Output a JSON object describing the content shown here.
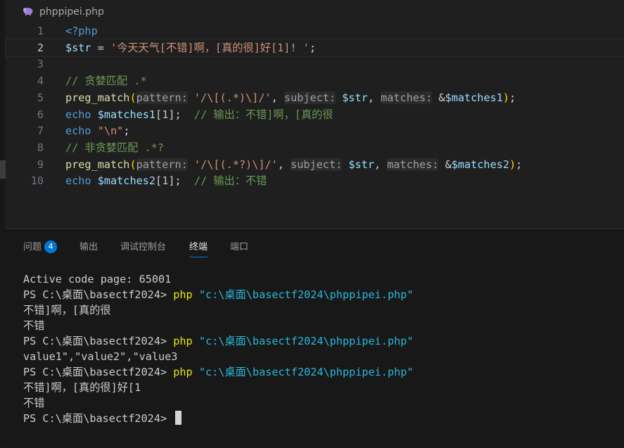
{
  "tab": {
    "filename": "phppipei.php",
    "icon": "php-elephant-icon"
  },
  "editor": {
    "lines": [
      {
        "num": "1",
        "parts": [
          {
            "c": "t-tag",
            "t": "<?php"
          }
        ]
      },
      {
        "num": "2",
        "active": true,
        "parts": [
          {
            "c": "t-var",
            "t": "$str"
          },
          {
            "c": "t-op",
            "t": " = "
          },
          {
            "c": "t-str",
            "t": "'今天天气[不错]啊，[真的很]好[1]! '"
          },
          {
            "c": "t-pun",
            "t": ";"
          }
        ]
      },
      {
        "num": "3",
        "parts": []
      },
      {
        "num": "4",
        "parts": [
          {
            "c": "t-com",
            "t": "// 贪婪匹配 .*"
          }
        ]
      },
      {
        "num": "5",
        "parts": [
          {
            "c": "t-fn",
            "t": "preg_match"
          },
          {
            "c": "t-br",
            "t": "("
          },
          {
            "c": "t-hint",
            "t": "pattern:"
          },
          {
            "c": "t-pun",
            "t": " "
          },
          {
            "c": "t-str",
            "t": "'/\\[(.*)\\]/'"
          },
          {
            "c": "t-pun",
            "t": ", "
          },
          {
            "c": "t-hint",
            "t": "subject:"
          },
          {
            "c": "t-pun",
            "t": " "
          },
          {
            "c": "t-var",
            "t": "$str"
          },
          {
            "c": "t-pun",
            "t": ", "
          },
          {
            "c": "t-hint",
            "t": "matches:"
          },
          {
            "c": "t-pun",
            "t": " &"
          },
          {
            "c": "t-var",
            "t": "$matches1"
          },
          {
            "c": "t-br",
            "t": ")"
          },
          {
            "c": "t-pun",
            "t": ";"
          }
        ]
      },
      {
        "num": "6",
        "parts": [
          {
            "c": "t-tag",
            "t": "echo"
          },
          {
            "c": "t-pun",
            "t": " "
          },
          {
            "c": "t-var",
            "t": "$matches1"
          },
          {
            "c": "t-pun",
            "t": "["
          },
          {
            "c": "t-num",
            "t": "1"
          },
          {
            "c": "t-pun",
            "t": "];  "
          },
          {
            "c": "t-com",
            "t": "// 输出：不错]啊，[真的很"
          }
        ]
      },
      {
        "num": "7",
        "parts": [
          {
            "c": "t-tag",
            "t": "echo"
          },
          {
            "c": "t-pun",
            "t": " "
          },
          {
            "c": "t-str",
            "t": "\"\\n\""
          },
          {
            "c": "t-pun",
            "t": ";"
          }
        ]
      },
      {
        "num": "8",
        "parts": [
          {
            "c": "t-com",
            "t": "// 非贪婪匹配 .*?"
          }
        ]
      },
      {
        "num": "9",
        "parts": [
          {
            "c": "t-fn",
            "t": "preg_match"
          },
          {
            "c": "t-br",
            "t": "("
          },
          {
            "c": "t-hint",
            "t": "pattern:"
          },
          {
            "c": "t-pun",
            "t": " "
          },
          {
            "c": "t-str",
            "t": "'/\\[(.*?)\\]/'"
          },
          {
            "c": "t-pun",
            "t": ", "
          },
          {
            "c": "t-hint",
            "t": "subject:"
          },
          {
            "c": "t-pun",
            "t": " "
          },
          {
            "c": "t-var",
            "t": "$str"
          },
          {
            "c": "t-pun",
            "t": ", "
          },
          {
            "c": "t-hint",
            "t": "matches:"
          },
          {
            "c": "t-pun",
            "t": " &"
          },
          {
            "c": "t-var",
            "t": "$matches2"
          },
          {
            "c": "t-br",
            "t": ")"
          },
          {
            "c": "t-pun",
            "t": ";"
          }
        ]
      },
      {
        "num": "10",
        "parts": [
          {
            "c": "t-tag",
            "t": "echo"
          },
          {
            "c": "t-pun",
            "t": " "
          },
          {
            "c": "t-var",
            "t": "$matches2"
          },
          {
            "c": "t-pun",
            "t": "["
          },
          {
            "c": "t-num",
            "t": "1"
          },
          {
            "c": "t-pun",
            "t": "];  "
          },
          {
            "c": "t-com",
            "t": "// 输出：不错"
          }
        ]
      }
    ]
  },
  "panel": {
    "tabs": [
      {
        "label": "问题",
        "badge": "4"
      },
      {
        "label": "输出"
      },
      {
        "label": "调试控制台"
      },
      {
        "label": "终端",
        "active": true
      },
      {
        "label": "端口"
      }
    ]
  },
  "terminal": {
    "lines": [
      {
        "parts": [
          {
            "c": "",
            "t": "Active code page: 65001"
          }
        ]
      },
      {
        "parts": [
          {
            "c": "",
            "t": "PS C:\\桌面\\basectf2024> "
          },
          {
            "c": "t-cmd",
            "t": "php"
          },
          {
            "c": "",
            "t": " "
          },
          {
            "c": "t-path",
            "t": "\"c:\\桌面\\basectf2024\\phppipei.php\""
          }
        ]
      },
      {
        "parts": [
          {
            "c": "",
            "t": "不错]啊，[真的很"
          }
        ]
      },
      {
        "parts": [
          {
            "c": "",
            "t": "不错"
          }
        ]
      },
      {
        "parts": [
          {
            "c": "",
            "t": "PS C:\\桌面\\basectf2024> "
          },
          {
            "c": "t-cmd",
            "t": "php"
          },
          {
            "c": "",
            "t": " "
          },
          {
            "c": "t-path",
            "t": "\"c:\\桌面\\basectf2024\\phppipei.php\""
          }
        ]
      },
      {
        "parts": [
          {
            "c": "",
            "t": "value1\",\"value2\",\"value3"
          }
        ]
      },
      {
        "parts": [
          {
            "c": "",
            "t": "PS C:\\桌面\\basectf2024> "
          },
          {
            "c": "t-cmd",
            "t": "php"
          },
          {
            "c": "",
            "t": " "
          },
          {
            "c": "t-path",
            "t": "\"c:\\桌面\\basectf2024\\phppipei.php\""
          }
        ]
      },
      {
        "parts": [
          {
            "c": "",
            "t": "不错]啊，[真的很]好[1"
          }
        ]
      },
      {
        "parts": [
          {
            "c": "",
            "t": "不错"
          }
        ]
      },
      {
        "parts": [
          {
            "c": "",
            "t": "PS C:\\桌面\\basectf2024> "
          }
        ],
        "cursor": true
      }
    ]
  }
}
